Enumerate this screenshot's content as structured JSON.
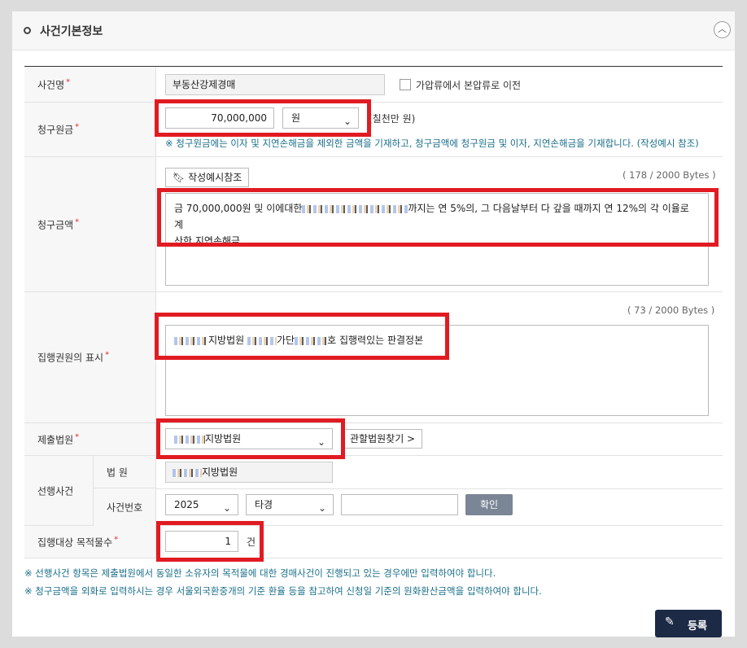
{
  "section": {
    "title": "사건기본정보",
    "collapse_icon": "chevron-up-icon"
  },
  "case_name": {
    "label": "사건명",
    "value": "부동산강제경매",
    "checkbox_label": "가압류에서 본압류로 이전"
  },
  "claim_principal": {
    "label": "청구원금",
    "value": "70,000,000",
    "currency": "원",
    "unit_hint": "(칠천만 원)",
    "note": "※ 청구원금에는 이자 및 지연손해금을 제외한 금액을 기재하고, 청구금액에 청구원금 및 이자, 지연손해금을 기재합니다. (작성예시 참조)"
  },
  "claim_amount": {
    "label": "청구금액",
    "example_button": "작성예시참조",
    "bytes": "( 178 / 2000 Bytes )",
    "text_start": "금 70,000,000원 및 이에대한",
    "text_end": "까지는 연 5%의, 그 다음날부터 다 갚을 때까지 연 12%의 각 이율로 계",
    "text_line2": "산한 지연손해금"
  },
  "title_of_execution": {
    "label": "집행권원의 표시",
    "bytes": "( 73 / 2000 Bytes )",
    "part1": "지방법원",
    "part2": "가단",
    "part3": "호 집행력있는 판결정본"
  },
  "court": {
    "label": "제출법원",
    "value": "지방법원",
    "find_button": "관할법원찾기 >"
  },
  "prior_case": {
    "label": "선행사건",
    "court_label": "법 원",
    "court_value": "지방법원",
    "case_no_label": "사건번호",
    "year": "2025",
    "type": "타경",
    "confirm_button": "확인"
  },
  "object_count": {
    "label": "집행대상 목적물수",
    "value": "1",
    "unit": "건"
  },
  "footnotes": [
    "※ 선행사건 항목은 제출법원에서 동일한 소유자의 목적물에 대한 경매사건이 진행되고 있는 경우에만 입력하여야 합니다.",
    "※ 청구금액을 외화로 입력하시는 경우 서울외국환중개의 기준 환율 등을 참고하여 신청일 기준의 원화환산금액을 입력하여야 합니다."
  ],
  "submit": {
    "label": "등록"
  }
}
